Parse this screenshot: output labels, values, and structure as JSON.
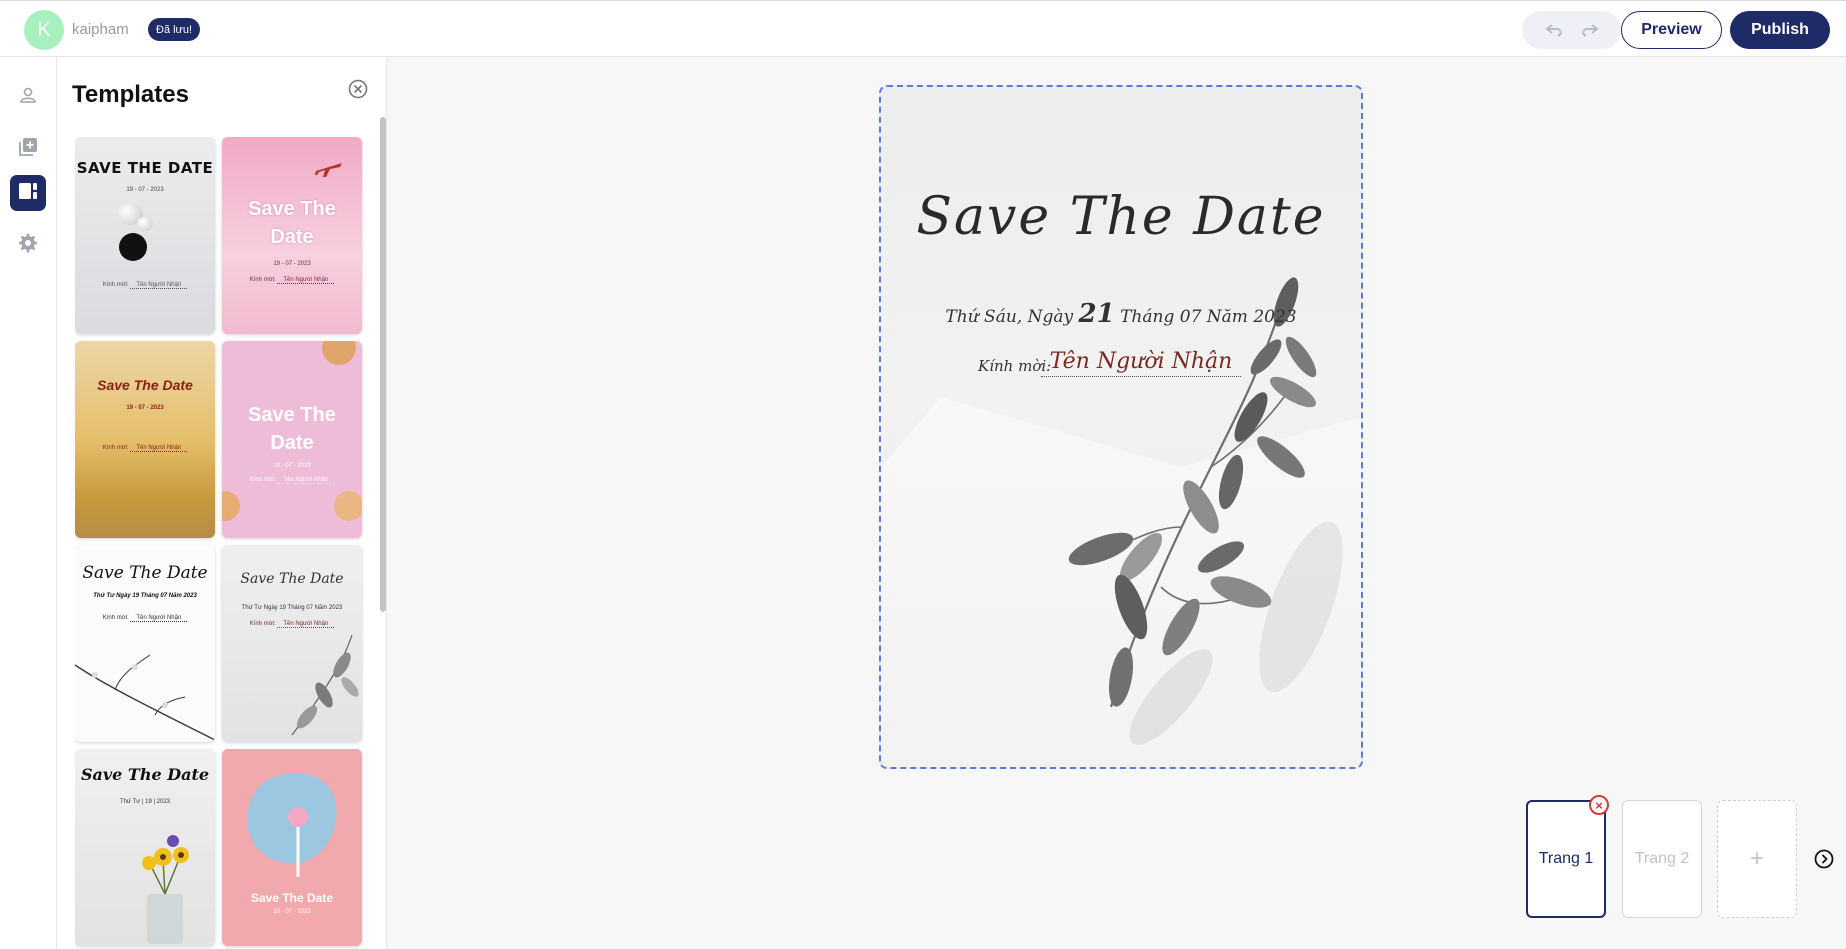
{
  "header": {
    "avatar_initial": "K",
    "username": "kaipham",
    "saved_badge": "Đã lưu!",
    "undo_icon": "undo-icon",
    "redo_icon": "redo-icon",
    "preview_label": "Preview",
    "publish_label": "Publish"
  },
  "rail": {
    "items": [
      {
        "icon": "user-icon"
      },
      {
        "icon": "add-page-icon"
      },
      {
        "icon": "templates-icon",
        "active": true
      },
      {
        "icon": "gear-icon"
      }
    ]
  },
  "templates": {
    "title": "Templates",
    "close_icon": "close-circle-icon",
    "items": [
      {
        "title": "SAVE THE DATE",
        "date": "19 - 07 - 2023",
        "invite": "Kính mời:",
        "recipient": "Tên Người Nhận",
        "bg": "#e3e4e6"
      },
      {
        "title": "Save The Date",
        "date": "19 - 07 - 2023",
        "invite": "Kính mời:",
        "recipient": "Tên Người Nhận",
        "bg": "#f1b9cf"
      },
      {
        "title": "Save The Date",
        "date": "19 - 07 - 2023",
        "invite": "Kính mời:",
        "recipient": "Tên Người Nhận",
        "bg": "#e2c57a"
      },
      {
        "title": "Save The Date",
        "date": "19 - 07 - 2023",
        "invite": "Kính mời:",
        "recipient": "Tên Người Nhận",
        "bg": "#eebcd8"
      },
      {
        "title": "Save The Date",
        "date": "Thứ Tư Ngày 19 Tháng 07 Năm 2023",
        "invite": "Kính mời:",
        "recipient": "Tên Người Nhận",
        "bg": "#fbfbfb"
      },
      {
        "title": "Save The Date",
        "date": "Thứ Tư Ngày 19 Tháng 07 Năm 2023",
        "invite": "Kính mời:",
        "recipient": "Tên Người Nhận",
        "bg": "#ececec"
      },
      {
        "title": "Save The Date",
        "date": "Thứ Tư | 19 | 2023",
        "invite": "",
        "recipient": "",
        "bg": "#eeeeee"
      },
      {
        "title": "Save The Date",
        "date": "19 - 07 - 2023",
        "invite": "",
        "recipient": "",
        "bg": "#f2a9ad"
      }
    ]
  },
  "card": {
    "title": "Save The Date",
    "date_prefix": "Thứ Sáu, Ngày",
    "day": "21",
    "date_suffix": "Tháng 07 Năm 2023",
    "invite_label": "Kính mời:",
    "recipient": "Tên Người Nhận"
  },
  "pages": {
    "items": [
      {
        "label": "Trang 1",
        "active": true
      },
      {
        "label": "Trang 2",
        "active": false
      }
    ],
    "add_label": "+",
    "remove_label": "×",
    "next_icon": "chevron-right-circle-icon"
  }
}
